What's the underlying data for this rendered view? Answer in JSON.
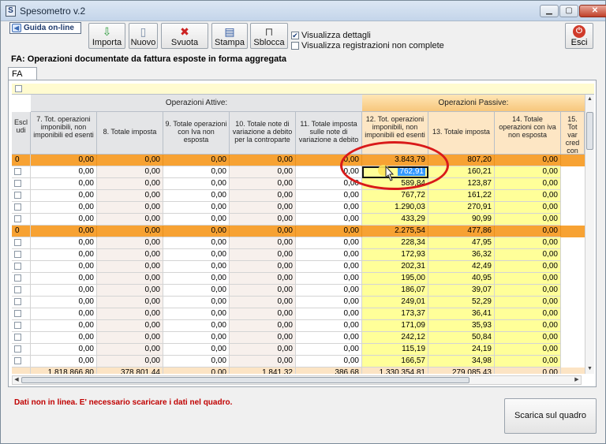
{
  "window": {
    "title": "Spesometro v.2",
    "app_icon_letter": "S"
  },
  "toolbar": {
    "help_label": "Guida on-line",
    "buttons": [
      {
        "name": "importa",
        "label": "Importa",
        "icon": "import-icon",
        "glyph": "⇩",
        "color": "#2e9b3d"
      },
      {
        "name": "nuovo",
        "label": "Nuovo",
        "icon": "new-document-icon",
        "glyph": "▯",
        "color": "#7a8ea8"
      },
      {
        "name": "svuota",
        "label": "Svuota",
        "icon": "delete-icon",
        "glyph": "✖",
        "color": "#cc2222"
      },
      {
        "name": "stampa",
        "label": "Stampa",
        "icon": "printer-icon",
        "glyph": "▤",
        "color": "#2c56a0"
      },
      {
        "name": "sblocca",
        "label": "Sblocca",
        "icon": "lock-icon",
        "glyph": "⊓",
        "color": "#555555"
      }
    ],
    "checkboxes": [
      {
        "label": "Visualizza dettagli",
        "checked": true
      },
      {
        "label": "Visualizza registrazioni non complete",
        "checked": false
      }
    ],
    "exit_label": "Esci"
  },
  "section_title": "FA: Operazioni documentate da fattura esposte in forma aggregata",
  "tab_label": "FA",
  "grid": {
    "group_attive": "Operazioni Attive:",
    "group_passive": "Operazioni Passive:",
    "excl_header": "Escl\nudi",
    "headers": [
      "7. Tot. operazioni imponibili, non imponibili ed esenti",
      "8. Totale imposta",
      "9. Totale operazioni con Iva non esposta",
      "10. Totale note di variazione a debito per la controparte",
      "11. Totale imposta sulle note di variazione a debito",
      "12. Tot. operazioni imponibili, non imponibili ed esenti",
      "13. Totale imposta",
      "14. Totale operazioni con iva non esposta",
      "15. Tot var cred con"
    ],
    "rows": [
      {
        "type": "group",
        "excl": "0",
        "v": [
          "0,00",
          "0,00",
          "0,00",
          "0,00",
          "0,00",
          "3.843,79",
          "807,20",
          "0,00"
        ]
      },
      {
        "type": "data",
        "v": [
          "0,00",
          "0,00",
          "0,00",
          "0,00",
          "0,00",
          "762,91",
          "160,21",
          "0,00"
        ]
      },
      {
        "type": "data",
        "v": [
          "0,00",
          "0,00",
          "0,00",
          "0,00",
          "0,00",
          "589,84",
          "123,87",
          "0,00"
        ]
      },
      {
        "type": "data",
        "v": [
          "0,00",
          "0,00",
          "0,00",
          "0,00",
          "0,00",
          "767,72",
          "161,22",
          "0,00"
        ]
      },
      {
        "type": "data",
        "v": [
          "0,00",
          "0,00",
          "0,00",
          "0,00",
          "0,00",
          "1.290,03",
          "270,91",
          "0,00"
        ]
      },
      {
        "type": "data",
        "v": [
          "0,00",
          "0,00",
          "0,00",
          "0,00",
          "0,00",
          "433,29",
          "90,99",
          "0,00"
        ]
      },
      {
        "type": "group",
        "excl": "0",
        "v": [
          "0,00",
          "0,00",
          "0,00",
          "0,00",
          "0,00",
          "2.275,54",
          "477,86",
          "0,00"
        ]
      },
      {
        "type": "data",
        "v": [
          "0,00",
          "0,00",
          "0,00",
          "0,00",
          "0,00",
          "228,34",
          "47,95",
          "0,00"
        ]
      },
      {
        "type": "data",
        "v": [
          "0,00",
          "0,00",
          "0,00",
          "0,00",
          "0,00",
          "172,93",
          "36,32",
          "0,00"
        ]
      },
      {
        "type": "data",
        "v": [
          "0,00",
          "0,00",
          "0,00",
          "0,00",
          "0,00",
          "202,31",
          "42,49",
          "0,00"
        ]
      },
      {
        "type": "data",
        "v": [
          "0,00",
          "0,00",
          "0,00",
          "0,00",
          "0,00",
          "195,00",
          "40,95",
          "0,00"
        ]
      },
      {
        "type": "data",
        "v": [
          "0,00",
          "0,00",
          "0,00",
          "0,00",
          "0,00",
          "186,07",
          "39,07",
          "0,00"
        ]
      },
      {
        "type": "data",
        "v": [
          "0,00",
          "0,00",
          "0,00",
          "0,00",
          "0,00",
          "249,01",
          "52,29",
          "0,00"
        ]
      },
      {
        "type": "data",
        "v": [
          "0,00",
          "0,00",
          "0,00",
          "0,00",
          "0,00",
          "173,37",
          "36,41",
          "0,00"
        ]
      },
      {
        "type": "data",
        "v": [
          "0,00",
          "0,00",
          "0,00",
          "0,00",
          "0,00",
          "171,09",
          "35,93",
          "0,00"
        ]
      },
      {
        "type": "data",
        "v": [
          "0,00",
          "0,00",
          "0,00",
          "0,00",
          "0,00",
          "242,12",
          "50,84",
          "0,00"
        ]
      },
      {
        "type": "data",
        "v": [
          "0,00",
          "0,00",
          "0,00",
          "0,00",
          "0,00",
          "115,19",
          "24,19",
          "0,00"
        ]
      },
      {
        "type": "data",
        "v": [
          "0,00",
          "0,00",
          "0,00",
          "0,00",
          "0,00",
          "166,57",
          "34,98",
          "0,00"
        ]
      }
    ],
    "totals": [
      "1.818.866,80",
      "378.801,44",
      "0,00",
      "1.841,32",
      "386,68",
      "1.330.354,81",
      "279.085,43",
      "0,00"
    ],
    "selected": {
      "row": 1,
      "col": 5
    },
    "colors": {
      "group_row": "#f7a233",
      "passive_cell": "#ffff99",
      "active_cell": "#ffffff",
      "totals_row": "#fce4c4"
    }
  },
  "status_message": "Dati non in linea. E' necessario scaricare i dati nel quadro.",
  "scarica_label": "Scarica sul quadro"
}
